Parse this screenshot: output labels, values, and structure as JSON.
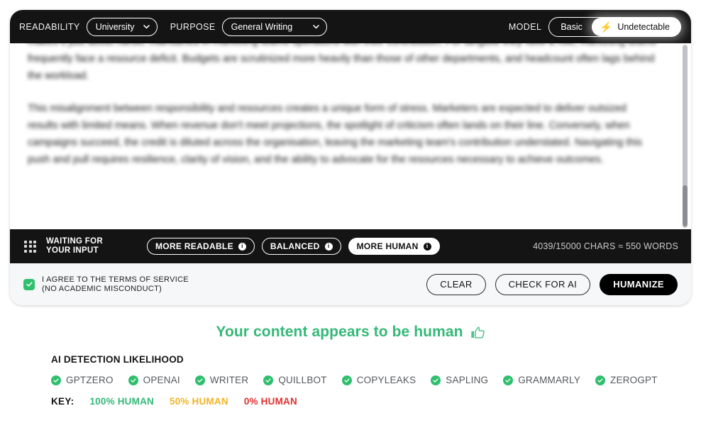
{
  "controls": {
    "readability_label": "READABILITY",
    "readability_value": "University",
    "purpose_label": "PURPOSE",
    "purpose_value": "General Writing",
    "model_label": "MODEL",
    "model_basic": "Basic",
    "model_undetectable": "Undetectable",
    "bolt_icon": "⚡"
  },
  "editor": {
    "paragraph_1": "makes it just about harder maintained in marketing teams operations with their contribution. For tangible they fulfill a role, marketing teams frequently face a resource deficit. Budgets are scrutinized more heavily than those of other departments, and headcount often lags behind the workload.",
    "paragraph_2": "This misalignment between responsibility and resources creates a unique form of stress. Marketers are expected to deliver outsized results with limited means. When revenue don't meet projections, the spotlight of criticism often lands on their line. Conversely, when campaigns succeed, the credit is diluted across the organisation, leaving the marketing team's contribution understated. Navigating this push and pull requires resilience, clarity of vision, and the ability to advocate for the resources necessary to achieve outcomes."
  },
  "status_bar": {
    "status_text": "WAITING FOR\nYOUR INPUT",
    "grid_icon": "grid-dots-icon",
    "tones": [
      {
        "label": "MORE READABLE",
        "active": false,
        "info": "i"
      },
      {
        "label": "BALANCED",
        "active": false,
        "info": "i"
      },
      {
        "label": "MORE HUMAN",
        "active": true,
        "info": "i"
      }
    ],
    "char_count": "4039/15000 CHARS ≈ 550 WORDS"
  },
  "actions": {
    "terms_text": "I AGREE TO THE TERMS OF SERVICE\n(NO ACADEMIC MISCONDUCT)",
    "terms_checked": true,
    "clear_label": "CLEAR",
    "check_ai_label": "CHECK FOR AI",
    "humanize_label": "HUMANIZE"
  },
  "results": {
    "headline": "Your content appears to be human",
    "headline_color": "#34b877",
    "thumbs_up_icon": "thumbs-up-icon",
    "detection_title": "AI DETECTION LIKELIHOOD",
    "detectors": [
      {
        "name": "GPTZERO",
        "status": "pass"
      },
      {
        "name": "OPENAI",
        "status": "pass"
      },
      {
        "name": "WRITER",
        "status": "pass"
      },
      {
        "name": "QUILLBOT",
        "status": "pass"
      },
      {
        "name": "COPYLEAKS",
        "status": "pass"
      },
      {
        "name": "SAPLING",
        "status": "pass"
      },
      {
        "name": "GRAMMARLY",
        "status": "pass"
      },
      {
        "name": "ZEROGPT",
        "status": "pass"
      }
    ],
    "key_label": "KEY:",
    "key_items": [
      {
        "label": "100% HUMAN",
        "color": "#34b877"
      },
      {
        "label": "50% HUMAN",
        "color": "#f0b429"
      },
      {
        "label": "0% HUMAN",
        "color": "#e03030"
      }
    ]
  }
}
